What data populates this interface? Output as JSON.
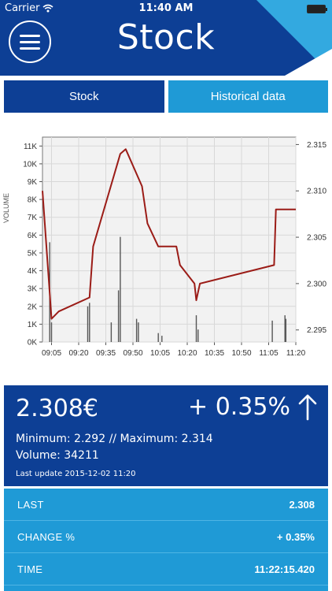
{
  "status_bar": {
    "carrier": "Carrier",
    "time": "11:40 AM"
  },
  "header": {
    "title": "Stock"
  },
  "tabs": [
    {
      "label": "Stock",
      "active": true
    },
    {
      "label": "Historical data",
      "active": false
    }
  ],
  "chart_data": {
    "type": "line",
    "xlabel": "",
    "ylabel_left": "VOLUME",
    "x_ticks": [
      "09:05",
      "09:20",
      "09:35",
      "09:50",
      "10:05",
      "10:20",
      "10:35",
      "10:50",
      "11:05",
      "11:20"
    ],
    "y_left_ticks": [
      "0K",
      "1K",
      "2K",
      "3K",
      "4K",
      "5K",
      "6K",
      "7K",
      "8K",
      "9K",
      "10K",
      "11K"
    ],
    "y_left_lim": [
      0,
      11500
    ],
    "y_right_ticks": [
      "2.295",
      "2.300",
      "2.305",
      "2.310",
      "2.315"
    ],
    "y_right_lim": [
      2.2937,
      2.3158
    ],
    "x_lim_minutes": [
      540,
      680
    ],
    "price_series": {
      "x_minutes": [
        540,
        545,
        549,
        566,
        568,
        583,
        586,
        595,
        598,
        604,
        614,
        616,
        624,
        625,
        627,
        668,
        669,
        680
      ],
      "y": [
        2.31,
        2.2962,
        2.297,
        2.2985,
        2.304,
        2.314,
        2.3145,
        2.3105,
        2.3065,
        2.304,
        2.304,
        2.302,
        2.3,
        2.2982,
        2.3,
        2.302,
        2.308,
        2.308
      ]
    },
    "volume_series": {
      "x_minutes": [
        544,
        545,
        565,
        566,
        578,
        582,
        583,
        592,
        593,
        604,
        606,
        625,
        626,
        667,
        674,
        674.5
      ],
      "values": [
        5600,
        1100,
        2000,
        2200,
        1100,
        2900,
        5900,
        1300,
        1100,
        500,
        350,
        1500,
        700,
        1200,
        1500,
        1300
      ]
    },
    "grid": true
  },
  "summary": {
    "price": "2.308€",
    "change": "+ 0.35%",
    "direction": "up",
    "minmax": "Minimum: 2.292 // Maximum: 2.314",
    "volume": "Volume: 34211",
    "updated": "Last update 2015-12-02 11:20"
  },
  "details": [
    {
      "label": "LAST",
      "value": "2.308"
    },
    {
      "label": "CHANGE %",
      "value": "+ 0.35%"
    },
    {
      "label": "TIME",
      "value": "11:22:15.420"
    }
  ],
  "colors": {
    "primary": "#0d3f95",
    "secondary": "#1f9ad6",
    "price_line": "#9b1c17",
    "plot_bg": "#f2f2f2"
  }
}
